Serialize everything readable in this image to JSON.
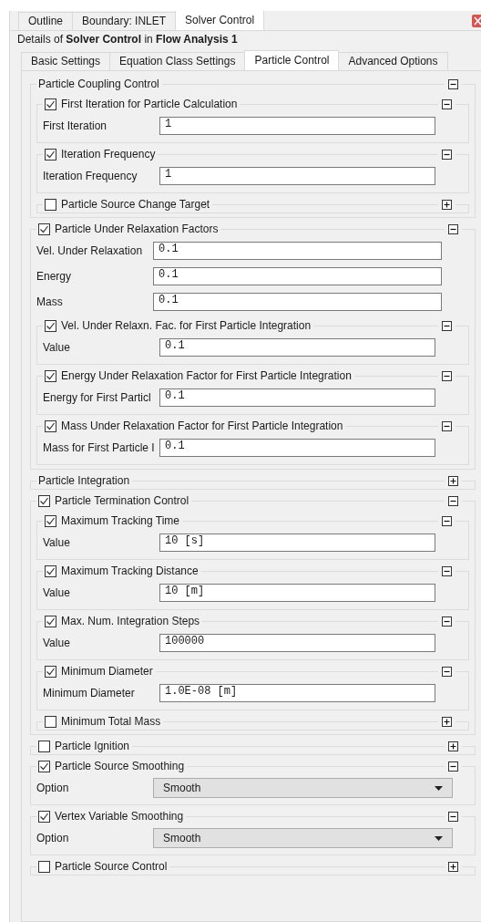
{
  "top_tabs": [
    {
      "label": "Outline",
      "selected": false
    },
    {
      "label": "Boundary: INLET",
      "selected": false
    },
    {
      "label": "Solver Control",
      "selected": true
    }
  ],
  "details_heading": "Details of **Solver Control** in **Flow Analysis 1**",
  "sub_tabs": [
    {
      "label": "Basic Settings",
      "selected": false
    },
    {
      "label": "Equation Class Settings",
      "selected": false
    },
    {
      "label": "Particle Control",
      "selected": true
    },
    {
      "label": "Advanced Options",
      "selected": false
    }
  ],
  "groups": [
    {
      "kind": "group",
      "title": "Particle Coupling Control",
      "expanded": true,
      "items": [
        {
          "kind": "group",
          "title": "First Iteration for Particle Calculation",
          "checked": true,
          "expanded": true,
          "items": [
            {
              "kind": "field",
              "label": "First Iteration",
              "value": "1"
            }
          ]
        },
        {
          "kind": "group",
          "title": "Iteration Frequency",
          "checked": true,
          "expanded": true,
          "items": [
            {
              "kind": "field",
              "label": "Iteration Frequency",
              "value": "1"
            }
          ]
        },
        {
          "kind": "group",
          "title": "Particle Source Change Target",
          "checked": false,
          "expanded": false
        }
      ]
    },
    {
      "kind": "group",
      "title": "Particle Under Relaxation Factors",
      "checked": true,
      "expanded": true,
      "items": [
        {
          "kind": "field",
          "label": "Vel. Under Relaxation",
          "value": "0.1"
        },
        {
          "kind": "field",
          "label": "Energy",
          "value": "0.1"
        },
        {
          "kind": "field",
          "label": "Mass",
          "value": "0.1"
        },
        {
          "kind": "group",
          "title": "Vel. Under Relaxn. Fac. for First Particle Integration",
          "checked": true,
          "expanded": true,
          "items": [
            {
              "kind": "field",
              "label": "Value",
              "value": "0.1"
            }
          ]
        },
        {
          "kind": "group",
          "title": "Energy Under Relaxation Factor for First Particle Integration",
          "checked": true,
          "expanded": true,
          "items": [
            {
              "kind": "field",
              "label": "Energy for First Particl",
              "value": "0.1"
            }
          ]
        },
        {
          "kind": "group",
          "title": "Mass Under Relaxation Factor for First Particle Integration",
          "checked": true,
          "expanded": true,
          "items": [
            {
              "kind": "field",
              "label": "Mass for First Particle I",
              "value": "0.1"
            }
          ]
        }
      ]
    },
    {
      "kind": "group",
      "title": "Particle Integration",
      "expanded": false
    },
    {
      "kind": "group",
      "title": "Particle Termination Control",
      "checked": true,
      "expanded": true,
      "items": [
        {
          "kind": "group",
          "title": "Maximum Tracking Time",
          "checked": true,
          "expanded": true,
          "items": [
            {
              "kind": "field",
              "label": "Value",
              "value": "10 [s]"
            }
          ]
        },
        {
          "kind": "group",
          "title": "Maximum Tracking Distance",
          "checked": true,
          "expanded": true,
          "items": [
            {
              "kind": "field",
              "label": "Value",
              "value": "10 [m]"
            }
          ]
        },
        {
          "kind": "group",
          "title": "Max. Num. Integration Steps",
          "checked": true,
          "expanded": true,
          "items": [
            {
              "kind": "field",
              "label": "Value",
              "value": "100000"
            }
          ]
        },
        {
          "kind": "group",
          "title": "Minimum Diameter",
          "checked": true,
          "expanded": true,
          "items": [
            {
              "kind": "field",
              "label": "Minimum Diameter",
              "value": "1.0E-08 [m]"
            }
          ]
        },
        {
          "kind": "group",
          "title": "Minimum Total Mass",
          "checked": false,
          "expanded": false
        }
      ]
    },
    {
      "kind": "group",
      "title": "Particle Ignition",
      "checked": false,
      "expanded": false
    },
    {
      "kind": "group",
      "title": "Particle Source Smoothing",
      "checked": true,
      "expanded": true,
      "items": [
        {
          "kind": "select",
          "label": "Option",
          "value": "Smooth"
        }
      ]
    },
    {
      "kind": "group",
      "title": "Vertex Variable Smoothing",
      "checked": true,
      "expanded": true,
      "items": [
        {
          "kind": "select",
          "label": "Option",
          "value": "Smooth"
        }
      ]
    },
    {
      "kind": "group",
      "title": "Particle Source Control",
      "checked": false,
      "expanded": false
    }
  ]
}
